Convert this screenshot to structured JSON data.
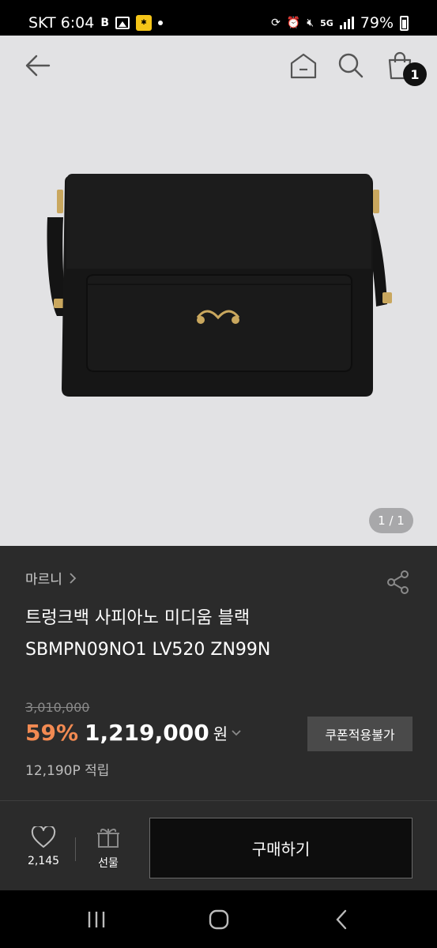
{
  "status_bar": {
    "carrier_time": "SKT 6:04",
    "network": "5G",
    "battery": "79%"
  },
  "nav": {
    "cart_count": "1"
  },
  "hero": {
    "pager": "1 / 1"
  },
  "product": {
    "brand": "마르니",
    "title_line1": "트렁크백 사피아노 미디움 블랙",
    "title_line2": "SBMPN09NO1 LV520 ZN99N",
    "original_price": "3,010,000",
    "discount": "59%",
    "price": "1,219,000",
    "currency": "원",
    "coupon_label": "쿠폰적용불가",
    "points": "12,190P 적립"
  },
  "actions": {
    "like_count": "2,145",
    "gift_label": "선물",
    "buy_label": "구매하기"
  },
  "colors": {
    "discount": "#f28a52",
    "panel": "#2b2b2b",
    "hero_bg": "#e2e2e4"
  }
}
